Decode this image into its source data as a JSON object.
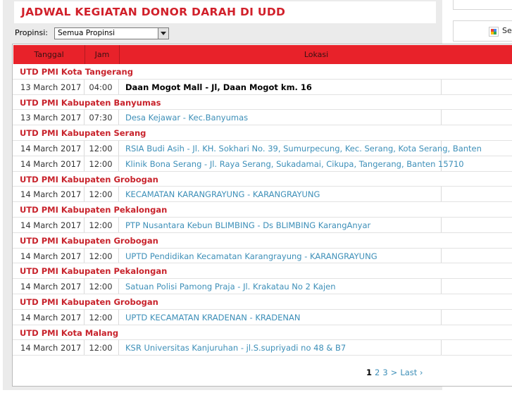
{
  "title": "JADWAL KEGIATAN DONOR DARAH DI UDD",
  "filter": {
    "label": "Propinsi:",
    "selected": "Semua Propinsi"
  },
  "table": {
    "headers": {
      "date": "Tanggal",
      "time": "Jam",
      "location": "Lokasi"
    },
    "rows": [
      {
        "type": "group",
        "label": "UTD PMI Kota Tangerang"
      },
      {
        "type": "item",
        "date": "13 March 2017",
        "time": "04:00",
        "location": "Daan Mogot Mall - Jl, Daan Mogot km. 16",
        "bold": true
      },
      {
        "type": "group",
        "label": "UTD PMI Kabupaten Banyumas"
      },
      {
        "type": "item",
        "date": "13 March 2017",
        "time": "07:30",
        "location": "Desa Kejawar - Kec.Banyumas"
      },
      {
        "type": "group",
        "label": "UTD PMI Kabupaten Serang"
      },
      {
        "type": "item",
        "date": "14 March 2017",
        "time": "12:00",
        "location": "RSIA Budi Asih - Jl. KH. Sokhari No. 39, Sumurpecung, Kec. Serang, Kota Serang, Banten"
      },
      {
        "type": "item",
        "date": "14 March 2017",
        "time": "12:00",
        "location": "Klinik Bona Serang - Jl. Raya Serang, Sukadamai, Cikupa, Tangerang, Banten 15710"
      },
      {
        "type": "group",
        "label": "UTD PMI Kabupaten Grobogan"
      },
      {
        "type": "item",
        "date": "14 March 2017",
        "time": "12:00",
        "location": "KECAMATAN KARANGRAYUNG - KARANGRAYUNG"
      },
      {
        "type": "group",
        "label": "UTD PMI Kabupaten Pekalongan"
      },
      {
        "type": "item",
        "date": "14 March 2017",
        "time": "12:00",
        "location": "PTP Nusantara Kebun BLIMBING - Ds BLIMBING KarangAnyar"
      },
      {
        "type": "group",
        "label": "UTD PMI Kabupaten Grobogan"
      },
      {
        "type": "item",
        "date": "14 March 2017",
        "time": "12:00",
        "location": "UPTD Pendidikan Kecamatan Karangrayung - KARANGRAYUNG"
      },
      {
        "type": "group",
        "label": "UTD PMI Kabupaten Pekalongan"
      },
      {
        "type": "item",
        "date": "14 March 2017",
        "time": "12:00",
        "location": "Satuan Polisi Pamong Praja - Jl. Krakatau No 2 Kajen"
      },
      {
        "type": "group",
        "label": "UTD PMI Kabupaten Grobogan"
      },
      {
        "type": "item",
        "date": "14 March 2017",
        "time": "12:00",
        "location": "UPTD KECAMATAN KRADENAN - KRADENAN"
      },
      {
        "type": "group",
        "label": "UTD PMI Kota Malang"
      },
      {
        "type": "item",
        "date": "14 March 2017",
        "time": "12:00",
        "location": "KSR Universitas Kanjuruhan - jl.S.supriyadi no 48 & B7"
      }
    ]
  },
  "pagination": {
    "current": "1",
    "pages": [
      "2",
      "3"
    ],
    "next": ">",
    "last": "Last ›"
  },
  "right_column": {
    "button_text": "Se"
  },
  "colors": {
    "header_red": "#e8222a",
    "group_red": "#c8232c",
    "link_blue": "#3d8fb8"
  }
}
